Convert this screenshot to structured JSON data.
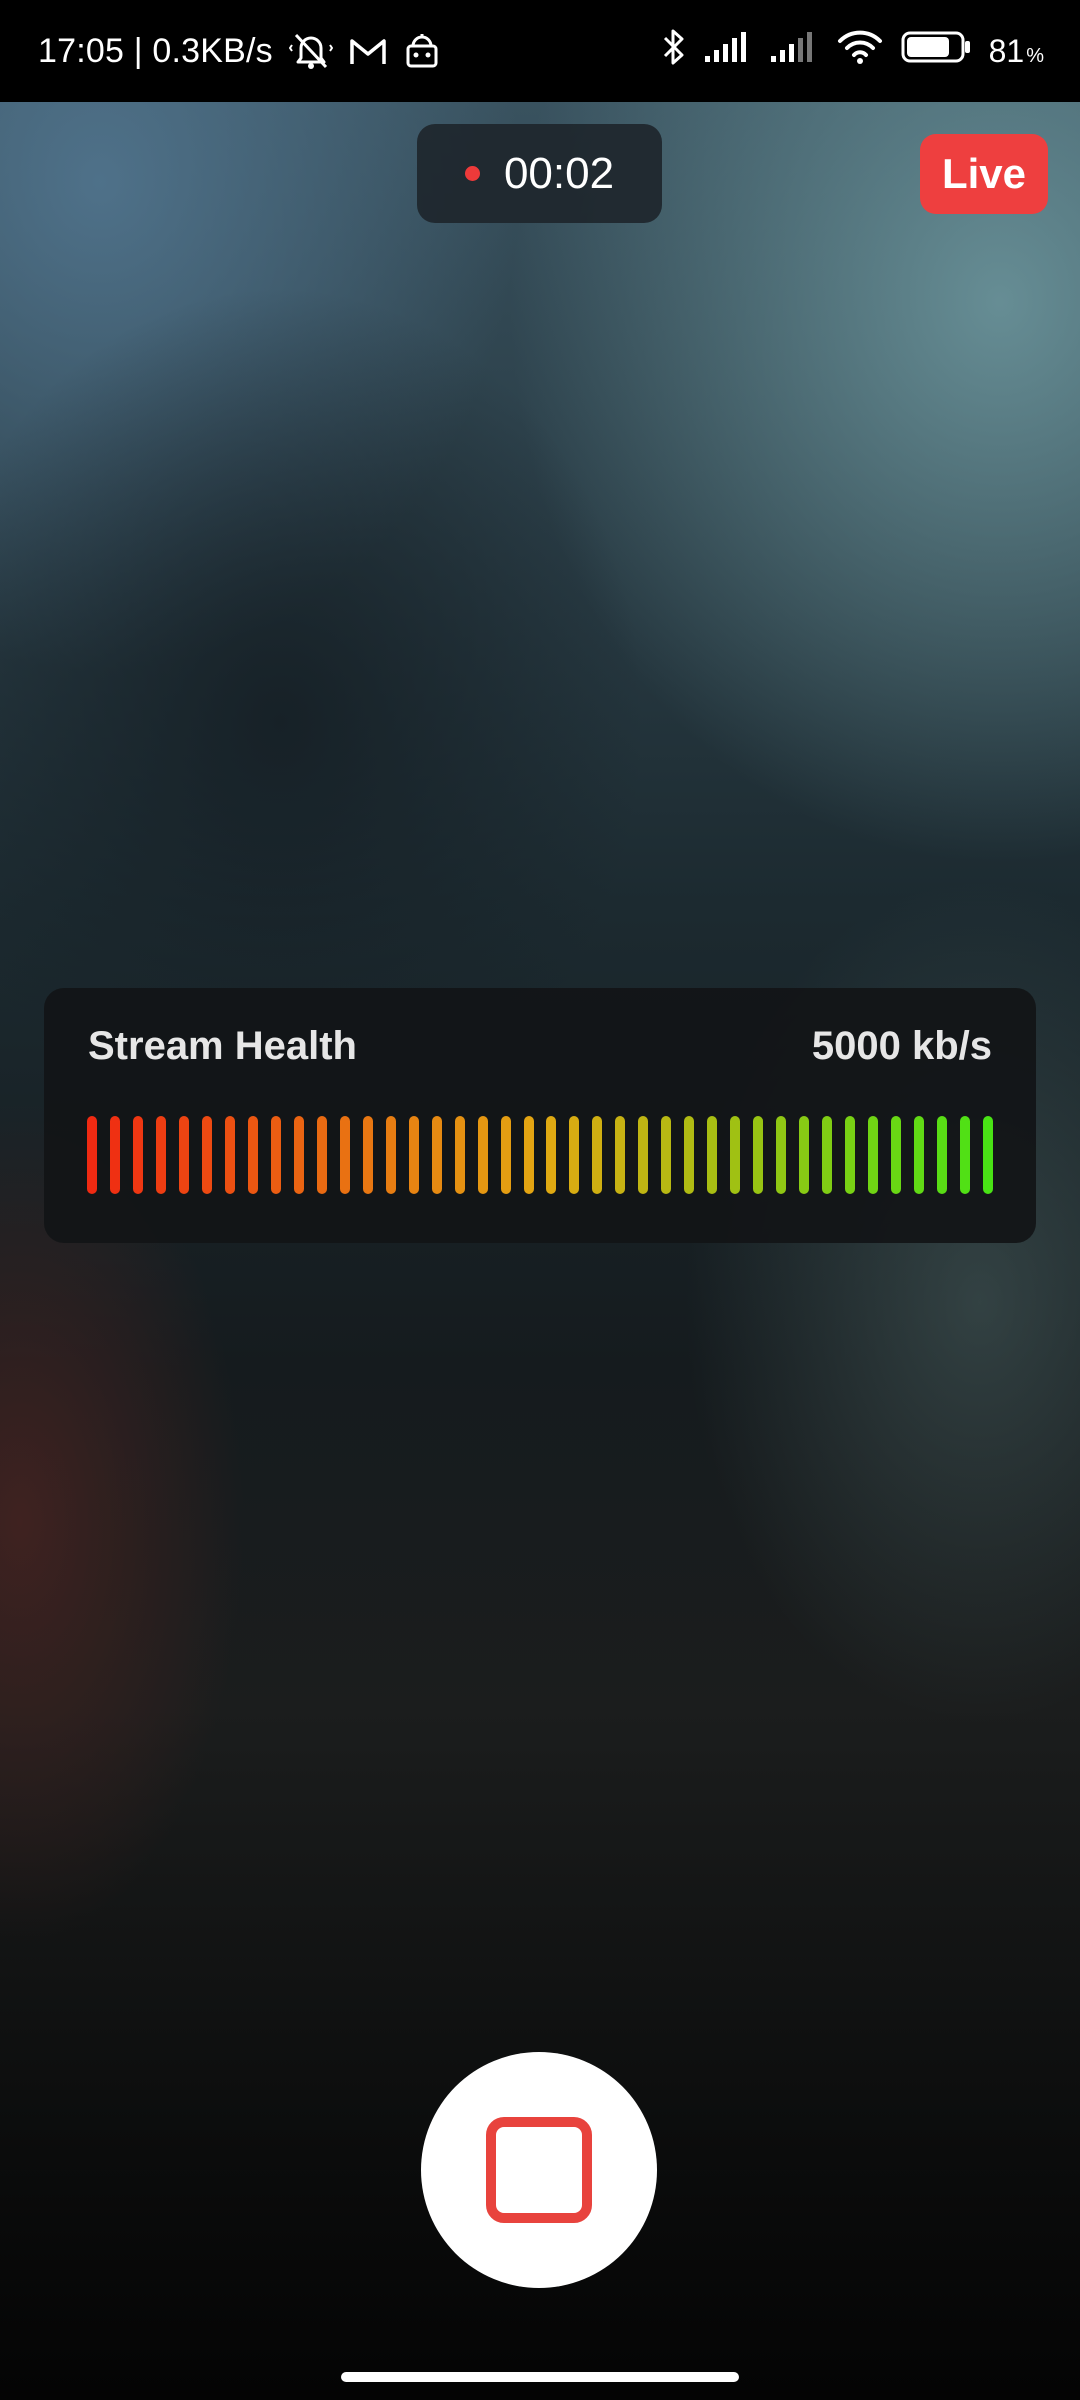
{
  "status_bar": {
    "time_speed": "17:05 | 0.3KB/s",
    "left_icons": [
      "mute-vibrate-icon",
      "gmail-icon",
      "app-notification-icon"
    ],
    "right_icons": [
      "bluetooth-icon",
      "cell-signal-1-icon",
      "cell-signal-2-icon",
      "wifi-icon",
      "battery-icon"
    ],
    "battery_level": 0.81,
    "battery_percent": "81",
    "battery_unit": "%"
  },
  "recording": {
    "indicator_icon": "recording-dot-icon",
    "indicator_color": "#ee3a3a",
    "timer": "00:02"
  },
  "live_badge": {
    "label": "Live",
    "color": "#ee3f3f"
  },
  "stream_health": {
    "title": "Stream Health",
    "rate": "5000 kb/s",
    "meter": {
      "segments": 40,
      "active_segments": 40,
      "start_color": "#f02a12",
      "mid_color": "#e3a712",
      "end_color": "#49e315"
    }
  },
  "controls": {
    "stop_icon": "stop-icon",
    "stop_color": "#e8433d"
  }
}
